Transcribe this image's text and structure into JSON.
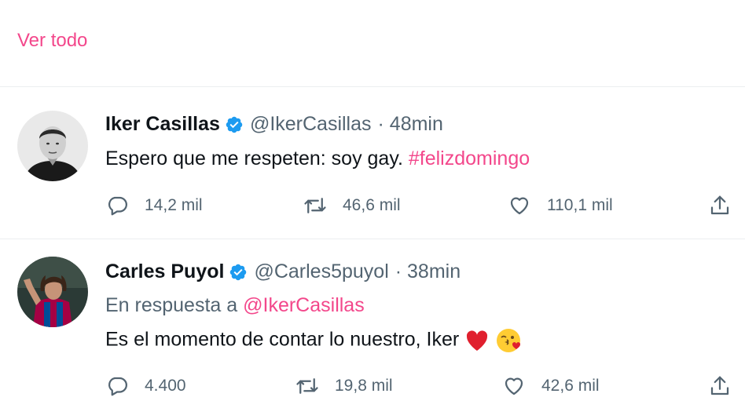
{
  "see_all_label": "Ver todo",
  "colors": {
    "accent": "#f3478b",
    "verified": "#1d9bf0",
    "muted": "#536471"
  },
  "tweets": [
    {
      "name": "Iker Casillas",
      "handle": "@IkerCasillas",
      "time": "· 48min",
      "text": "Espero que me respeten: soy gay.",
      "hashtag": "#felizdomingo",
      "replies": "14,2 mil",
      "retweets": "46,6 mil",
      "likes": "110,1 mil"
    },
    {
      "name": "Carles Puyol",
      "handle": "@Carles5puyol",
      "time": "· 38min",
      "reply_prefix": "En respuesta a",
      "reply_to": "@IkerCasillas",
      "text": "Es el momento de contar lo nuestro, Iker",
      "emojis": [
        "red-heart",
        "face-blowing-kiss"
      ],
      "replies": "4.400",
      "retweets": "19,8 mil",
      "likes": "42,6 mil"
    }
  ]
}
